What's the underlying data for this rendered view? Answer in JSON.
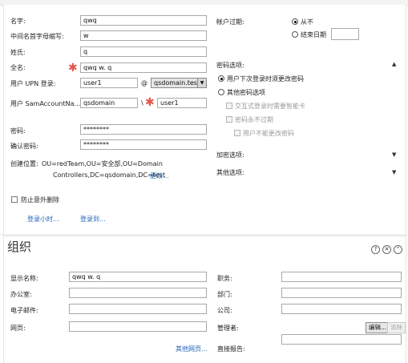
{
  "account": {
    "first_name_label": "名字:",
    "first_name_value": "qwq",
    "middle_initials_label": "中间名首字母缩写:",
    "middle_initials_value": "w",
    "last_name_label": "姓氏:",
    "last_name_value": "q",
    "full_name_label": "全名:",
    "full_name_value": "qwq w. q",
    "upn_label": "用户 UPN 登录:",
    "upn_user_value": "user1",
    "upn_at": "@",
    "upn_domain_value": "qsdomain.test",
    "sam_label": "用户 SamAccountNa...",
    "sam_domain_value": "qsdomain",
    "sam_sep": "\\",
    "sam_user_value": "user1",
    "password_label": "密码:",
    "password_value": "********",
    "confirm_password_label": "确认密码:",
    "confirm_password_value": "********",
    "create_in_label": "创建位置:",
    "create_in_line1": "OU=redTeam,OU=安全部,OU=Domain",
    "create_in_line2": "Controllers,DC=qsdomain,DC=test",
    "change_link": "更改...",
    "protect_label": "防止意外删除",
    "logon_hours_link": "登录小时...",
    "logon_to_link": "登录到...",
    "expires_label": "帐户过期:",
    "never_label": "从不",
    "end_date_label": "结束日期",
    "end_date_value": "",
    "password_options_label": "密码选项:",
    "opt_must_change": "用户下次登录时须更改密码",
    "opt_other": "其他密码选项",
    "opt_smartcard": "交互式登录时需要智能卡",
    "opt_never_expires": "密码永不过期",
    "opt_cannot_change": "用户不能更改密码",
    "encryption_label": "加密选项:",
    "other_options_label": "其他选项:"
  },
  "organization": {
    "title": "组织",
    "display_name_label": "显示名称:",
    "display_name_value": "qwq w. q",
    "office_label": "办公室:",
    "office_value": "",
    "email_label": "电子邮件:",
    "email_value": "",
    "webpage_label": "网页:",
    "webpage_value": "",
    "other_webpages_link": "其他网页...",
    "job_title_label": "职务:",
    "job_title_value": "",
    "department_label": "部门:",
    "department_value": "",
    "company_label": "公司:",
    "company_value": "",
    "manager_label": "管理者:",
    "manager_value": "",
    "edit_button": "编辑...",
    "clear_button": "清除",
    "direct_reports_label": "直接报告:",
    "help_icon_glyph": "?",
    "close_icon_glyph": "✕",
    "collapse_icon_glyph": "⌃"
  },
  "icons": {
    "required_marker": "✱",
    "dropdown_arrow": "▼",
    "expand_up": "▲",
    "expand_down": "▼"
  },
  "colors": {
    "link": "#1f63b8",
    "required": "#e5554a"
  }
}
